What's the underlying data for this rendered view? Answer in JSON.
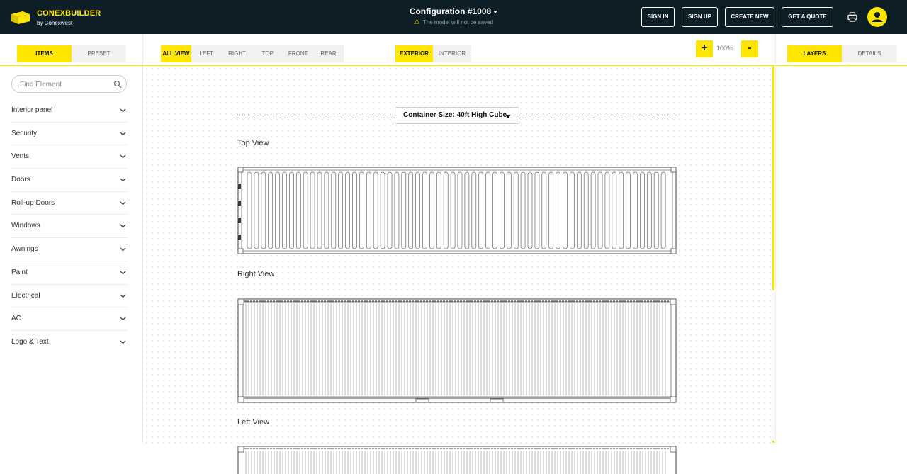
{
  "header": {
    "brand_title": "CONEXBUILDER",
    "brand_subtitle": "by Conexwest",
    "config_title": "Configuration #1008",
    "config_warning": "The model will not be saved",
    "buttons": {
      "sign_in": "SIGN IN",
      "sign_up": "SIGN UP",
      "create_new": "CREATE NEW",
      "get_quote": "GET A QUOTE"
    },
    "icons": {
      "logo": "container-logo-icon",
      "printer": "printer-icon",
      "user": "user-icon",
      "warning": "warning-icon"
    }
  },
  "left_panel": {
    "tabs": [
      {
        "label": "ITEMS",
        "active": true
      },
      {
        "label": "PRESET",
        "active": false
      }
    ],
    "search": {
      "placeholder": "Find Element"
    },
    "categories": [
      {
        "label": "Interior panel"
      },
      {
        "label": "Security"
      },
      {
        "label": "Vents"
      },
      {
        "label": "Doors"
      },
      {
        "label": "Roll-up Doors"
      },
      {
        "label": "Windows"
      },
      {
        "label": "Awnings"
      },
      {
        "label": "Paint"
      },
      {
        "label": "Electrical"
      },
      {
        "label": "AC"
      },
      {
        "label": "Logo & Text"
      }
    ]
  },
  "main": {
    "view_tabs": [
      {
        "label": "ALL VIEW",
        "active": true
      },
      {
        "label": "LEFT",
        "active": false
      },
      {
        "label": "RIGHT",
        "active": false
      },
      {
        "label": "TOP",
        "active": false
      },
      {
        "label": "FRONT",
        "active": false
      },
      {
        "label": "REAR",
        "active": false
      }
    ],
    "side_tabs": [
      {
        "label": "EXTERIOR",
        "active": true
      },
      {
        "label": "INTERIOR",
        "active": false
      }
    ],
    "zoom": {
      "plus": "+",
      "level": "100%",
      "minus": "-"
    },
    "container_size": "Container Size: 40ft High Cube",
    "views": {
      "top": "Top View",
      "right": "Right View",
      "left": "Left View"
    }
  },
  "right_panel": {
    "tabs": [
      {
        "label": "LAYERS",
        "active": true
      },
      {
        "label": "DETAILS",
        "active": false
      }
    ]
  },
  "colors": {
    "header_bg": "#0e1e26",
    "accent": "#ffe600"
  }
}
